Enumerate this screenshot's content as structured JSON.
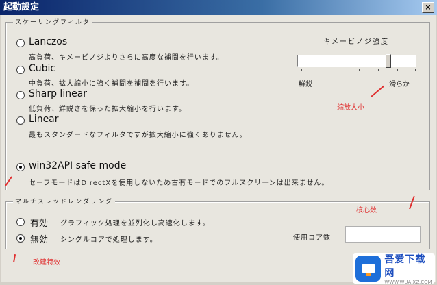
{
  "window": {
    "title": "起動設定",
    "close_glyph": "×"
  },
  "scaling_group": {
    "legend": "スケーリングフィルタ",
    "options": [
      {
        "label": "Lanczos",
        "desc": "高負荷、キメービノジよりさらに高度な補間を行います。",
        "checked": false
      },
      {
        "label": "Cubic",
        "desc": "中負荷、拡大縮小に強く補間を補間を行います。",
        "checked": false
      },
      {
        "label": "Sharp linear",
        "desc": "低負荷、鮮鋭さを保った拡大縮小を行います。",
        "checked": false
      },
      {
        "label": "Linear",
        "desc": "最もスタンダードなフィルタですが拡大縮小に強くありません。",
        "checked": false
      }
    ],
    "safe_mode": {
      "label": "win32API safe mode",
      "desc": "セーフモードはDirectXを使用しないため古有モードでのフルスクリーンは出来ません。",
      "checked": true
    },
    "slider": {
      "title": "キメービノジ強度",
      "left_label": "鮮鋭",
      "right_label": "滑らか",
      "value": 0.78
    }
  },
  "multicore_group": {
    "legend": "マルチスレッドレンダリング",
    "options": [
      {
        "label": "有効",
        "desc": "グラフィック処理を並列化し高速化します。",
        "checked": false
      },
      {
        "label": "無効",
        "desc": "シングルコアで処理します。",
        "checked": true
      }
    ],
    "usage_label": "使用コア数"
  },
  "annotations": {
    "scale_size": "缩放大小",
    "core_count": "核心数",
    "enable_mode": "改建特效"
  },
  "watermark": {
    "name": "吾爱下载网",
    "url": "WWW.WUAIXZ.COM"
  }
}
